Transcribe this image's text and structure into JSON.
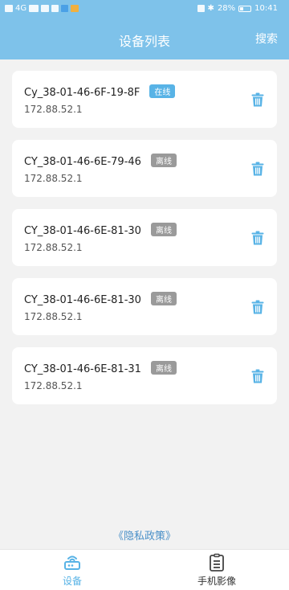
{
  "statusbar": {
    "left_text": "4G",
    "bluetooth": "✱",
    "battery": "28%",
    "time": "10:41"
  },
  "header": {
    "title": "设备列表",
    "search_label": "搜索"
  },
  "devices": [
    {
      "name": "Cy_38-01-46-6F-19-8F",
      "status": "在线",
      "ip": "172.88.52.1",
      "online": true
    },
    {
      "name": "CY_38-01-46-6E-79-46",
      "status": "离线",
      "ip": "172.88.52.1",
      "online": false
    },
    {
      "name": "CY_38-01-46-6E-81-30",
      "status": "离线",
      "ip": "172.88.52.1",
      "online": false
    },
    {
      "name": "CY_38-01-46-6E-81-30",
      "status": "离线",
      "ip": "172.88.52.1",
      "online": false
    },
    {
      "name": "CY_38-01-46-6E-81-31",
      "status": "离线",
      "ip": "172.88.52.1",
      "online": false
    }
  ],
  "footer": {
    "policy_link": "《隐私政策》"
  },
  "tabs": [
    {
      "label": "设备",
      "icon": "router-icon",
      "active": true
    },
    {
      "label": "手机影像",
      "icon": "document-icon",
      "active": false
    }
  ],
  "colors": {
    "header": "#7ec2ea",
    "accent": "#58b3e6",
    "offline": "#9a9a9a",
    "link": "#4a90c8"
  }
}
